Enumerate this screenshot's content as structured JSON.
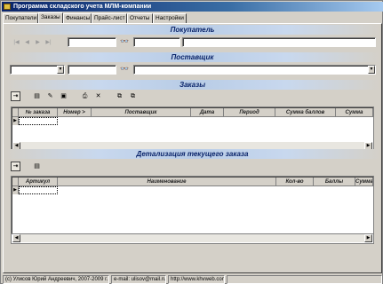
{
  "window": {
    "title": "Программа складского учета МЛМ-компании"
  },
  "tabs": [
    {
      "label": "Покупатели"
    },
    {
      "label": "Заказы"
    },
    {
      "label": "Финансы"
    },
    {
      "label": "Прайс-лист"
    },
    {
      "label": "Отчеты"
    },
    {
      "label": "Настройки"
    }
  ],
  "active_tab": "Заказы",
  "sections": {
    "buyer": "Покупатель",
    "supplier": "Поставщик",
    "orders": "Заказы",
    "detail": "Детализация текущего заказа"
  },
  "nav_buttons": [
    "first",
    "prior",
    "next",
    "last"
  ],
  "orders_grid": {
    "columns": [
      "№ заказа",
      "Номер >",
      "Поставщик",
      "Дата",
      "Период",
      "Сумма баллов",
      "Сумма"
    ],
    "rows": []
  },
  "detail_grid": {
    "columns": [
      "Артикул",
      "Наименование",
      "Кол-во",
      "Баллы",
      "Сумма б"
    ],
    "rows": []
  },
  "status_bar": {
    "copyright": "(c) Улисов Юрий Андреевич, 2007-2009 г.",
    "email": "e-mail: ulisov@mail.ru",
    "site": "http://www.khvweb.com"
  },
  "icons": {
    "search": "binoculars-icon",
    "toolbar_orders": [
      "exit-door-icon",
      "edit-document-icon",
      "new-document-icon",
      "delete-bin-icon",
      "printer-icon",
      "excel-icon",
      "copy-icon",
      "paste-icon"
    ],
    "toolbar_detail": [
      "exit-door-icon",
      "edit-document-icon"
    ]
  }
}
